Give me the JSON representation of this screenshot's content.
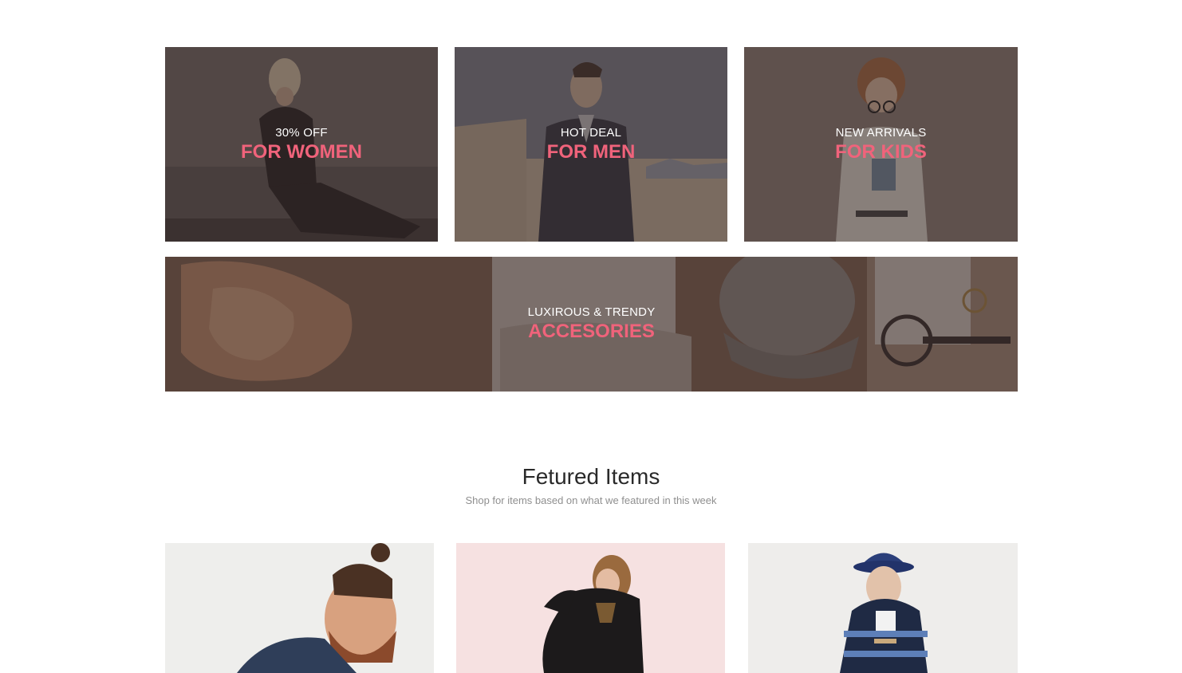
{
  "colors": {
    "accent": "#f0637b",
    "overlay": "#3a2e2d",
    "title_text": "#2a2a2a",
    "subtitle_text": "#8f8f8f"
  },
  "categories": [
    {
      "eyebrow": "30% OFF",
      "title": "FOR WOMEN"
    },
    {
      "eyebrow": "HOT DEAL",
      "title": "FOR MEN"
    },
    {
      "eyebrow": "NEW ARRIVALS",
      "title": "FOR KIDS"
    },
    {
      "eyebrow": "LUXIROUS & TRENDY",
      "title": "ACCESORIES"
    }
  ],
  "featured": {
    "title": "Fetured Items",
    "subtitle": "Shop for items based on what we featured in this week"
  },
  "products": [
    {
      "image": "man-with-beard-photo"
    },
    {
      "image": "woman-in-black-coat-photo"
    },
    {
      "image": "man-in-bucket-hat-photo"
    }
  ]
}
